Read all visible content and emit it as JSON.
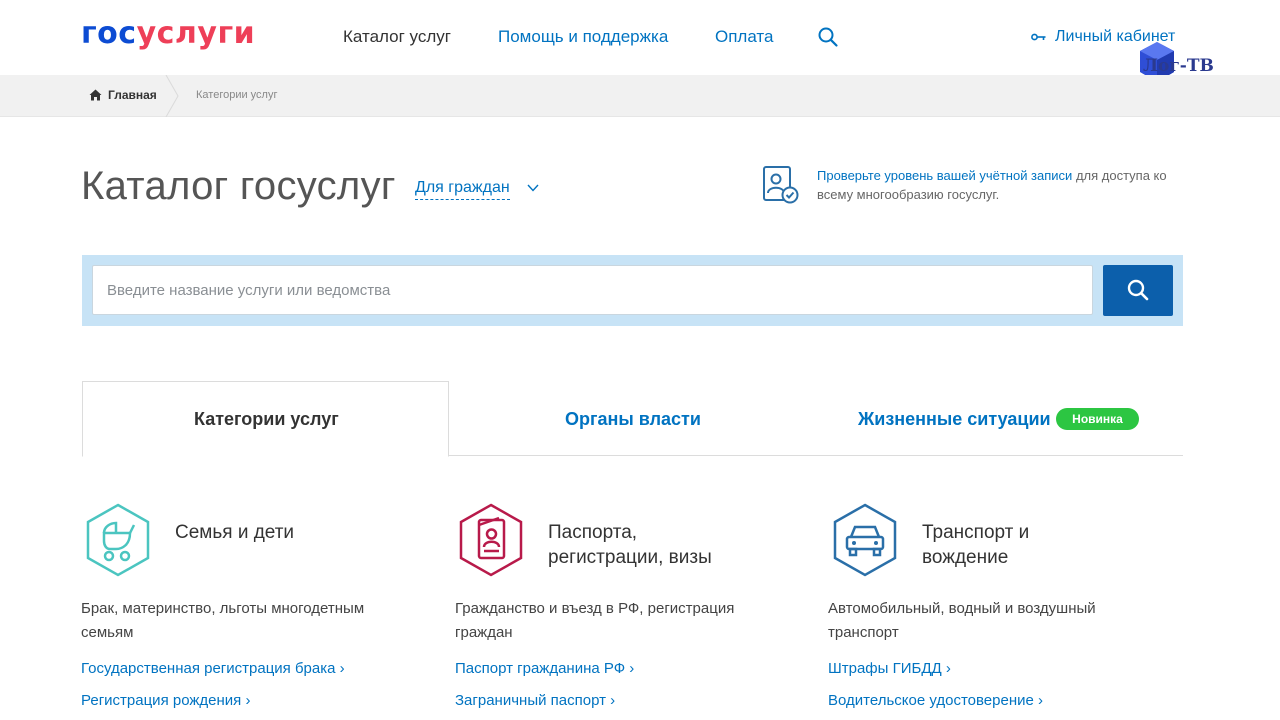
{
  "header": {
    "logo_part1": "гос",
    "logo_part2": "услуги",
    "nav": {
      "catalog": "Каталог услуг",
      "help": "Помощь и поддержка",
      "payment": "Оплата"
    },
    "cabinet": "Личный кабинет",
    "watermark": "Лог-ТВ"
  },
  "breadcrumb": {
    "home": "Главная",
    "current": "Категории услуг"
  },
  "page": {
    "title": "Каталог госуслуг",
    "audience": "Для граждан",
    "account_check_link": "Проверьте уровень вашей учётной записи",
    "account_check_rest": " для доступа ко всему многообразию госуслуг."
  },
  "search": {
    "placeholder": "Введите название услуги или ведомства",
    "value": ""
  },
  "tabs": [
    {
      "label": "Категории услуг",
      "active": true
    },
    {
      "label": "Органы власти",
      "active": false
    },
    {
      "label": "Жизненные ситуации",
      "active": false,
      "badge": "Новинка"
    }
  ],
  "categories": [
    {
      "icon": "baby-stroller-icon",
      "title_line1": "Семья и дети",
      "title_line2": "",
      "description": "Брак, материнство, льготы многодетным семьям",
      "links": [
        "Государственная регистрация брака",
        "Регистрация рождения"
      ],
      "color": "#4bc5c0"
    },
    {
      "icon": "passport-icon",
      "title_line1": "Паспорта,",
      "title_line2": "регистрации, визы",
      "description": "Гражданство и въезд в РФ, регистрация граждан",
      "links": [
        "Паспорт гражданина РФ",
        "Заграничный паспорт"
      ],
      "color": "#b81a4a"
    },
    {
      "icon": "car-icon",
      "title_line1": "Транспорт и",
      "title_line2": "вождение",
      "description": "Автомобильный, водный и воздушный транспорт",
      "links": [
        "Штрафы ГИБДД",
        "Водительское удостоверение"
      ],
      "color": "#2a6fa8"
    }
  ],
  "colors": {
    "brand_blue": "#0d4cd3",
    "brand_red": "#ee3f58",
    "link": "#0173c1",
    "search_band": "#c7e3f6",
    "search_button": "#0c5fab",
    "badge_green": "#2cc642"
  }
}
